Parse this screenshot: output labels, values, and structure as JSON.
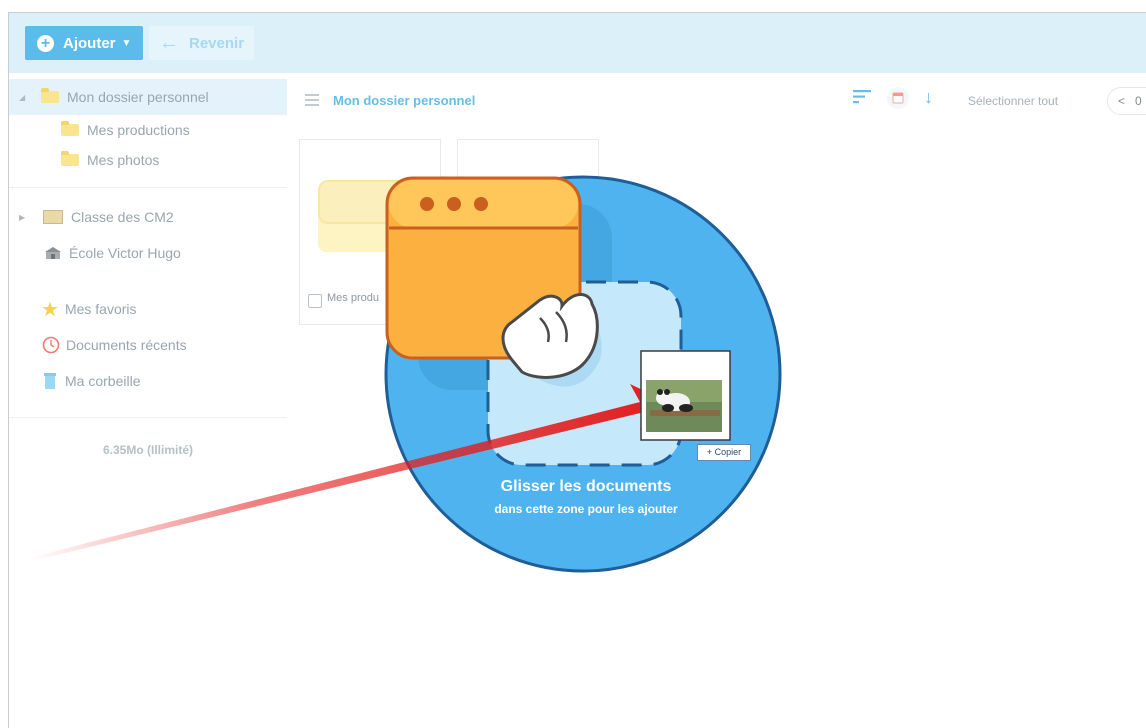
{
  "toolbar": {
    "add_label": "Ajouter",
    "back_label": "Revenir"
  },
  "sidebar": {
    "items": [
      {
        "label": "Mon dossier personnel"
      },
      {
        "label": "Mes productions"
      },
      {
        "label": "Mes photos"
      },
      {
        "label": "Classe des CM2"
      },
      {
        "label": "École Victor Hugo"
      },
      {
        "label": "Mes favoris"
      },
      {
        "label": "Documents récents"
      },
      {
        "label": "Ma corbeille"
      }
    ],
    "quota": "6.35Mo (Illimité)"
  },
  "content": {
    "breadcrumb": "Mon dossier personnel",
    "select_all": "Sélectionner tout",
    "pager": "0",
    "cards": [
      {
        "label": "Mes produ"
      }
    ]
  },
  "dropzone": {
    "title": "Glisser les documents",
    "subtitle": "dans cette zone pour les ajouter",
    "copy_badge": "+ Copier"
  },
  "colors": {
    "accent": "#5bbbea",
    "toolbar_bg": "#dcf0fa",
    "drop_circle": "#4fb3ef",
    "arrow": "#e31b1b",
    "window_orange": "#fbb040"
  }
}
